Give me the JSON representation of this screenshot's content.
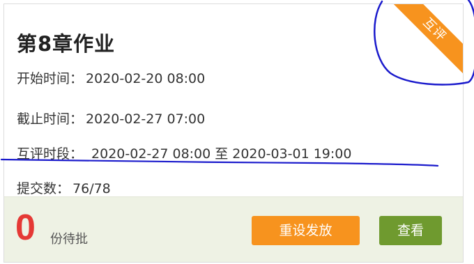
{
  "assignment": {
    "title": "第8章作业",
    "badge": "互评",
    "start_label": "开始时间：",
    "start_value": "2020-02-20 08:00",
    "end_label": "截止时间：",
    "end_value": "2020-02-27 07:00",
    "review_label": "互评时段：",
    "review_start": "2020-02-27 08:00",
    "review_sep": "至",
    "review_end": "2020-03-01 19:00",
    "submit_label": "提交数：",
    "submit_value": "76/78"
  },
  "footer": {
    "pending_count": "0",
    "pending_label": "份待批",
    "reset_button": "重设发放",
    "view_button": "查看"
  },
  "colors": {
    "badge": "#f7931e",
    "pending_count": "#e53935",
    "reset_button": "#f7931e",
    "view_button": "#6f9a2f",
    "annotation_ink": "#1a1acc"
  }
}
